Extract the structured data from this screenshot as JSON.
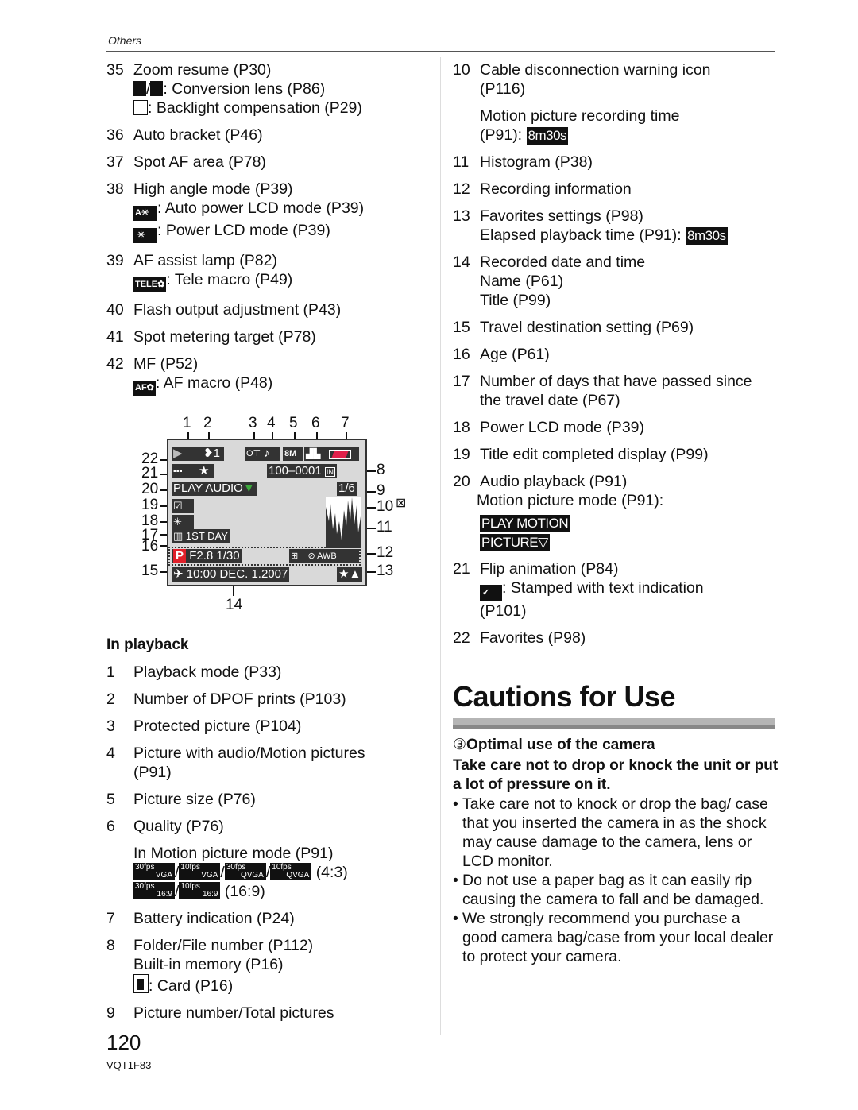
{
  "header": {
    "section": "Others"
  },
  "left_column": {
    "items_top": [
      {
        "num": "35",
        "lines": [
          "Zoom resume (P30)"
        ],
        "subs": [
          {
            "icons": [
              "conversion-lens-tele-icon",
              "conversion-lens-wide-icon"
            ],
            "text": ":  Conversion lens (P86)"
          },
          {
            "icons": [
              "backlight-icon"
            ],
            "text": ":  Backlight compensation (P29)"
          }
        ]
      },
      {
        "num": "36",
        "lines": [
          "Auto bracket (P46)"
        ]
      },
      {
        "num": "37",
        "lines": [
          "Spot AF area (P78)"
        ]
      },
      {
        "num": "38",
        "lines": [
          "High angle mode (P39)"
        ],
        "subs": [
          {
            "icons": [
              "auto-power-lcd-icon"
            ],
            "text": ":  Auto power LCD mode (P39)"
          },
          {
            "icons": [
              "power-lcd-icon"
            ],
            "text": ":  Power LCD mode (P39)"
          }
        ]
      },
      {
        "num": "39",
        "lines": [
          "AF assist lamp (P82)"
        ],
        "subs": [
          {
            "icons": [
              "tele-macro-icon"
            ],
            "icon_text": "TELE✿",
            "text": ":  Tele macro (P49)"
          }
        ]
      },
      {
        "num": "40",
        "lines": [
          "Flash output adjustment (P43)"
        ]
      },
      {
        "num": "41",
        "lines": [
          "Spot metering target (P78)"
        ]
      },
      {
        "num": "42",
        "lines": [
          "MF (P52)"
        ],
        "subs": [
          {
            "icons": [
              "af-macro-icon"
            ],
            "icon_text": "AF✿",
            "text": ":  AF macro (P48)"
          }
        ]
      }
    ],
    "playback_heading": "In playback",
    "playback_items": [
      {
        "num": "1",
        "lines": [
          "Playback mode (P33)"
        ]
      },
      {
        "num": "2",
        "lines": [
          "Number of DPOF prints (P103)"
        ]
      },
      {
        "num": "3",
        "lines": [
          "Protected picture (P104)"
        ]
      },
      {
        "num": "4",
        "lines": [
          "Picture with audio/Motion pictures",
          "(P91)"
        ]
      },
      {
        "num": "5",
        "lines": [
          "Picture size (P76)"
        ]
      },
      {
        "num": "6",
        "lines": [
          "Quality (P76)"
        ]
      },
      {
        "num": "7",
        "lines": [
          "Battery indication (P24)"
        ]
      },
      {
        "num": "8",
        "lines": [
          "Folder/File number (P112)",
          "Built-in memory (P16)"
        ],
        "card_text": ":  Card (P16)"
      },
      {
        "num": "9",
        "lines": [
          "Picture number/Total pictures"
        ]
      }
    ],
    "motion_mode": {
      "label": "In Motion picture mode (P91)",
      "row1": [
        {
          "top": "30fps",
          "bottom": "VGA"
        },
        {
          "top": "10fps",
          "bottom": "VGA"
        },
        {
          "top": "30fps",
          "bottom": "QVGA"
        },
        {
          "top": "10fps",
          "bottom": "QVGA"
        }
      ],
      "row1_suffix": "(4:3)",
      "row2": [
        {
          "top": "30fps",
          "bottom": "16:9"
        },
        {
          "top": "10fps",
          "bottom": "16:9"
        }
      ],
      "row2_suffix": "(16:9)",
      "separator": "/"
    }
  },
  "lcd_diagram": {
    "callouts_top": [
      "1",
      "2",
      "3",
      "4",
      "5",
      "6",
      "7"
    ],
    "callouts_left": [
      "22",
      "21",
      "20",
      "19",
      "18",
      "17",
      "16",
      "15"
    ],
    "callouts_right": [
      "8",
      "9",
      "10",
      "11",
      "12",
      "13"
    ],
    "callout_bottom": "14",
    "dpof_count": "1",
    "folder_file": "100–0001",
    "memory_tag": "IN",
    "play_mode": "PLAY AUDIO",
    "picture_count": "1/6",
    "travel_day": "1ST DAY",
    "mode_letter": "P",
    "exposure": "F2.8 1/30",
    "wb": "AWB",
    "datetime": "10:00  DEC.  1.2007",
    "picture_size": "8M",
    "colors": {
      "screen": "#d9d9d9",
      "chip": "#333333",
      "mode_p": "#e0202a",
      "battery": "#e0204a",
      "play_triangle": "#3caa3c"
    }
  },
  "right_column": {
    "items": [
      {
        "num": "10",
        "lines": [
          "Cable disconnection warning icon",
          "(P116)"
        ],
        "extra": {
          "lines": [
            "Motion picture recording time"
          ],
          "last_prefix": "(P91):  ",
          "tag": "8m30s"
        }
      },
      {
        "num": "11",
        "lines": [
          "Histogram (P38)"
        ]
      },
      {
        "num": "12",
        "lines": [
          "Recording information"
        ]
      },
      {
        "num": "13",
        "lines": [
          "Favorites settings (P98)"
        ],
        "extra_inline": {
          "prefix": "Elapsed playback time (P91):  ",
          "tag": "8m30s"
        }
      },
      {
        "num": "14",
        "lines": [
          "Recorded date and time",
          "Name (P61)",
          "Title (P99)"
        ]
      },
      {
        "num": "15",
        "lines": [
          "Travel destination setting (P69)"
        ]
      },
      {
        "num": "16",
        "lines": [
          "Age (P61)"
        ]
      },
      {
        "num": "17",
        "lines": [
          "Number of days that have passed since",
          "the travel date (P67)"
        ]
      },
      {
        "num": "18",
        "lines": [
          "Power LCD mode (P39)"
        ]
      },
      {
        "num": "19",
        "lines": [
          "Title edit completed display (P99)"
        ]
      },
      {
        "num": "20",
        "lines": [
          "Audio playback (P91)",
          "Motion picture mode (P91):"
        ],
        "tags": [
          "PLAY MOTION",
          "PICTURE▽"
        ]
      },
      {
        "num": "21",
        "lines": [
          "Flip animation (P84)"
        ],
        "stamp_text": ":  Stamped with text indication",
        "stamp_tail": "(P101)"
      },
      {
        "num": "22",
        "lines": [
          "Favorites (P98)"
        ]
      }
    ]
  },
  "cautions": {
    "title": "Cautions for Use",
    "subheading_marker": "③",
    "subheading": "Optimal use of the camera",
    "lead": "Take care not to drop or knock the unit or put a lot of pressure on it.",
    "bullet_char": "•",
    "bullets": [
      "Take care not to knock or drop the bag/ case that you inserted the camera in as the shock may cause damage to the camera, lens or LCD monitor.",
      "Do not use a paper bag as it can easily rip causing the camera to fall and be damaged.",
      "We strongly recommend you purchase a good camera bag/case from your local dealer to protect your camera."
    ]
  },
  "footer": {
    "page_number": "120",
    "doc_code": "VQT1F83"
  }
}
